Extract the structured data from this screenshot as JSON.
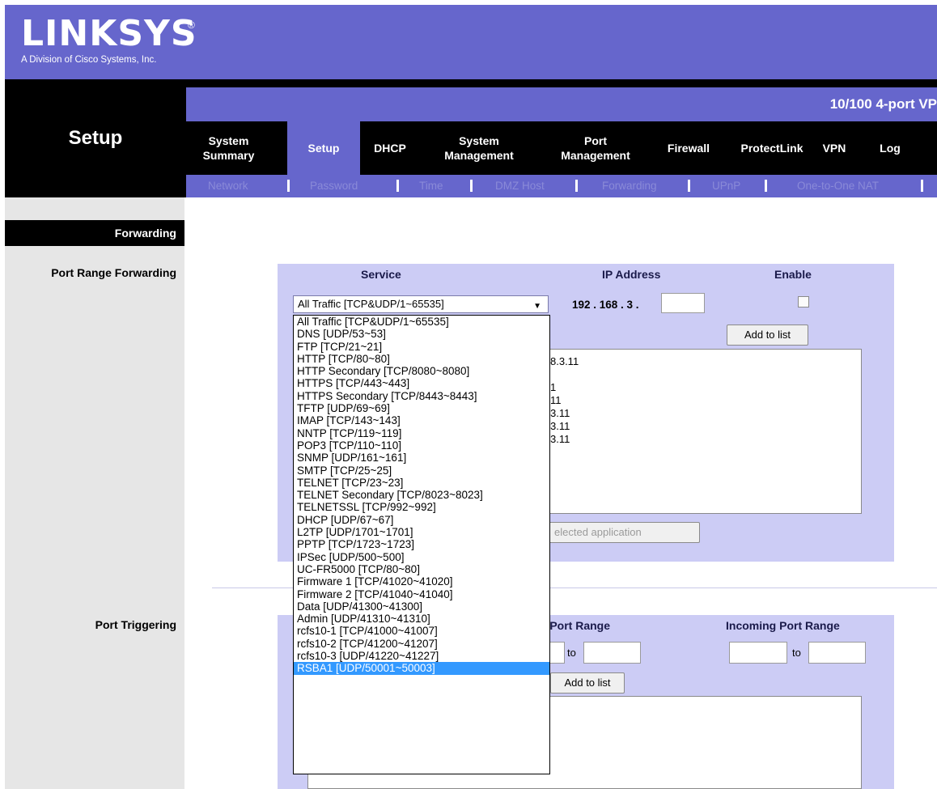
{
  "brand": {
    "logo": "LINKSYS",
    "registered": "®",
    "subtitle": "A Division of Cisco Systems, Inc.",
    "product": "10/100 4-port VP"
  },
  "page_title": "Setup",
  "nav": {
    "tabs": [
      {
        "line1": "System",
        "line2": "Summary"
      },
      {
        "line1": "Setup",
        "line2": ""
      },
      {
        "line1": "DHCP",
        "line2": ""
      },
      {
        "line1": "System",
        "line2": "Management"
      },
      {
        "line1": "Port",
        "line2": "Management"
      },
      {
        "line1": "Firewall",
        "line2": ""
      },
      {
        "line1": "ProtectLink",
        "line2": ""
      },
      {
        "line1": "VPN",
        "line2": ""
      },
      {
        "line1": "Log",
        "line2": ""
      }
    ],
    "active_tab": "Setup",
    "subtabs": [
      "Network",
      "Password",
      "Time",
      "DMZ Host",
      "Forwarding",
      "UPnP",
      "One-to-One NAT"
    ]
  },
  "sidebar": {
    "section": "Forwarding",
    "port_range_forwarding": "Port Range Forwarding",
    "port_triggering": "Port Triggering"
  },
  "prf": {
    "headers": {
      "service": "Service",
      "ip_address": "IP Address",
      "enable": "Enable"
    },
    "selected_service": "All Traffic [TCP&UDP/1~65535]",
    "ip_prefix": "192 . 168 . 3 .",
    "ip_last_octet": "",
    "enable_checked": false,
    "add_button": "Add to list",
    "list_fragments": [
      "8.3.11",
      "",
      "1",
      "11",
      "3.11",
      "3.11",
      "3.11"
    ],
    "delete_button": "elected application"
  },
  "trigger": {
    "headers": {
      "trigger_range": "r Port Range",
      "incoming_range": "Incoming Port Range"
    },
    "to_label": "to",
    "add_button": "Add to list"
  },
  "dropdown": {
    "options": [
      "All Traffic [TCP&UDP/1~65535]",
      "DNS [UDP/53~53]",
      "FTP [TCP/21~21]",
      "HTTP [TCP/80~80]",
      "HTTP Secondary [TCP/8080~8080]",
      "HTTPS [TCP/443~443]",
      "HTTPS Secondary [TCP/8443~8443]",
      "TFTP [UDP/69~69]",
      "IMAP [TCP/143~143]",
      "NNTP [TCP/119~119]",
      "POP3 [TCP/110~110]",
      "SNMP [UDP/161~161]",
      "SMTP [TCP/25~25]",
      "TELNET [TCP/23~23]",
      "TELNET Secondary [TCP/8023~8023]",
      "TELNETSSL [TCP/992~992]",
      "DHCP [UDP/67~67]",
      "L2TP [UDP/1701~1701]",
      "PPTP [TCP/1723~1723]",
      "IPSec [UDP/500~500]",
      "UC-FR5000 [TCP/80~80]",
      "Firmware 1 [TCP/41020~41020]",
      "Firmware 2 [TCP/41040~41040]",
      "Data [UDP/41300~41300]",
      "Admin [UDP/41310~41310]",
      "rcfs10-1 [TCP/41000~41007]",
      "rcfs10-2 [TCP/41200~41207]",
      "rcfs10-3 [UDP/41220~41227]",
      "RSBA1 [UDP/50001~50003]"
    ],
    "highlighted": "RSBA1 [UDP/50001~50003]"
  },
  "colors": {
    "brand_purple": "#6666cc",
    "panel": "#ccccf5",
    "subtab_text": "#8a8ad8",
    "highlight": "#3399ff"
  }
}
